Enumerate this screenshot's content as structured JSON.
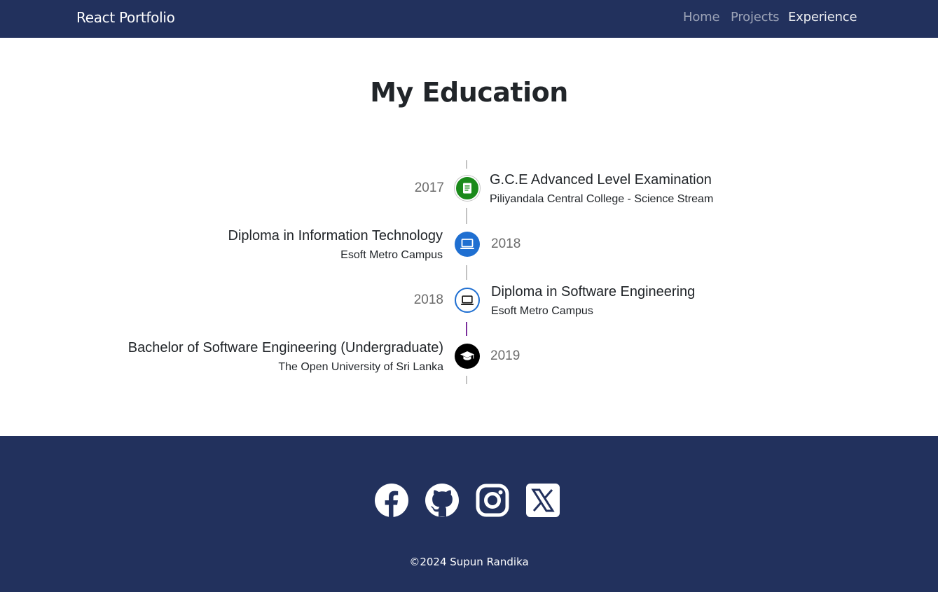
{
  "nav": {
    "brand": "React Portfolio",
    "links": [
      {
        "label": "Home",
        "active": false
      },
      {
        "label": "Projects",
        "active": false
      },
      {
        "label": "Experience",
        "active": true
      }
    ]
  },
  "section": {
    "title": "My Education"
  },
  "timeline": [
    {
      "year": "2017",
      "title": "G.C.E Advanced Level Examination",
      "subtitle": "Piliyandala Central College - Science Stream",
      "icon": "book-icon",
      "color": "#1a8a1a"
    },
    {
      "year": "2018",
      "title": "Diploma in Information Technology",
      "subtitle": "Esoft Metro Campus",
      "icon": "laptop-icon",
      "color": "#1f6fd1"
    },
    {
      "year": "2018",
      "title": "Diploma in Software Engineering",
      "subtitle": "Esoft Metro Campus",
      "icon": "laptop-icon",
      "color": "#ffffff"
    },
    {
      "year": "2019",
      "title": "Bachelor of Software Engineering (Undergraduate)",
      "subtitle": "The Open University of Sri Lanka",
      "icon": "graduation-cap-icon",
      "color": "#000000"
    }
  ],
  "footer": {
    "social": [
      "facebook-icon",
      "github-icon",
      "instagram-icon",
      "x-twitter-icon"
    ],
    "copyright": "©2024 Supun Randika"
  },
  "colors": {
    "navbar": "#22315d",
    "footer": "#22315d"
  }
}
